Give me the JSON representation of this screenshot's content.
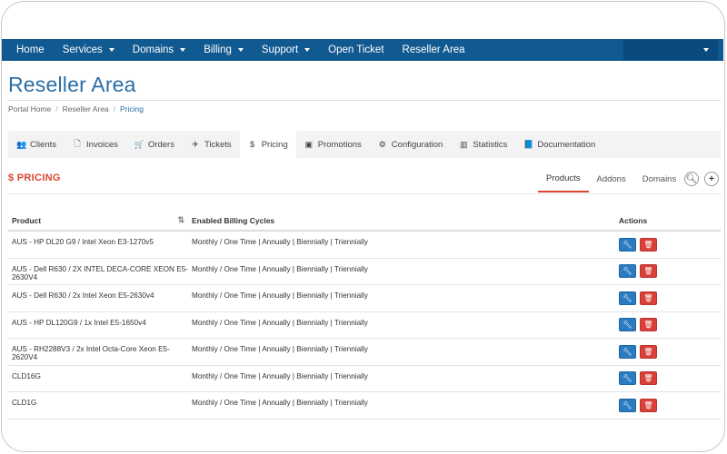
{
  "nav": {
    "items": [
      {
        "label": "Home",
        "dropdown": false
      },
      {
        "label": "Services",
        "dropdown": true
      },
      {
        "label": "Domains",
        "dropdown": true
      },
      {
        "label": "Billing",
        "dropdown": true
      },
      {
        "label": "Support",
        "dropdown": true
      },
      {
        "label": "Open Ticket",
        "dropdown": false
      },
      {
        "label": "Reseller Area",
        "dropdown": false
      }
    ]
  },
  "page": {
    "title": "Reseller Area",
    "breadcrumb": [
      "Portal Home",
      "Reseller Area",
      "Pricing"
    ]
  },
  "tabs": [
    {
      "label": "Clients",
      "icon": "users-icon",
      "glyph": "👥"
    },
    {
      "label": "Invoices",
      "icon": "file-icon",
      "glyph": "🗋"
    },
    {
      "label": "Orders",
      "icon": "cart-icon",
      "glyph": "🛒"
    },
    {
      "label": "Tickets",
      "icon": "ticket-icon",
      "glyph": "✈"
    },
    {
      "label": "Pricing",
      "icon": "dollar-icon",
      "glyph": "$",
      "active": true
    },
    {
      "label": "Promotions",
      "icon": "money-icon",
      "glyph": "▣"
    },
    {
      "label": "Configuration",
      "icon": "cogs-icon",
      "glyph": "⚙"
    },
    {
      "label": "Statistics",
      "icon": "bar-chart-icon",
      "glyph": "▥"
    },
    {
      "label": "Documentation",
      "icon": "book-icon",
      "glyph": "📘"
    }
  ],
  "section": {
    "title": "$ PRICING",
    "subtabs": [
      "Products",
      "Addons",
      "Domains"
    ]
  },
  "table": {
    "headers": {
      "product": "Product",
      "cycles": "Enabled Billing Cycles",
      "actions": "Actions"
    },
    "rows": [
      {
        "product": "AUS - HP DL20 G9 / Intel Xeon E3-1270v5",
        "cycles": "Monthly / One Time | Annually | Biennially | Triennially"
      },
      {
        "product": "AUS - Dell R630 / 2X INTEL DECA-CORE XEON E5-2630V4",
        "cycles": "Monthly / One Time | Annually | Biennially | Triennially"
      },
      {
        "product": "AUS - Dell R630 / 2x Intel Xeon E5-2630v4",
        "cycles": "Monthly / One Time | Annually | Biennially | Triennially"
      },
      {
        "product": "AUS - HP DL120G9 / 1x Intel E5-1650v4",
        "cycles": "Monthly / One Time | Annually | Biennially | Triennially"
      },
      {
        "product": "AUS - RH2288V3 / 2x Intel Octa-Core Xeon E5-2620V4",
        "cycles": "Monthly / One Time | Annually | Biennially | Triennially"
      },
      {
        "product": "CLD16G",
        "cycles": "Monthly / One Time | Annually | Biennially | Triennially"
      },
      {
        "product": "CLD1G",
        "cycles": "Monthly / One Time | Annually | Biennially | Triennially"
      }
    ]
  },
  "colors": {
    "navbar": "#115991",
    "title": "#2b6ea5",
    "accent": "#d9452d",
    "edit": "#2a7bc0",
    "delete": "#d9403a"
  }
}
